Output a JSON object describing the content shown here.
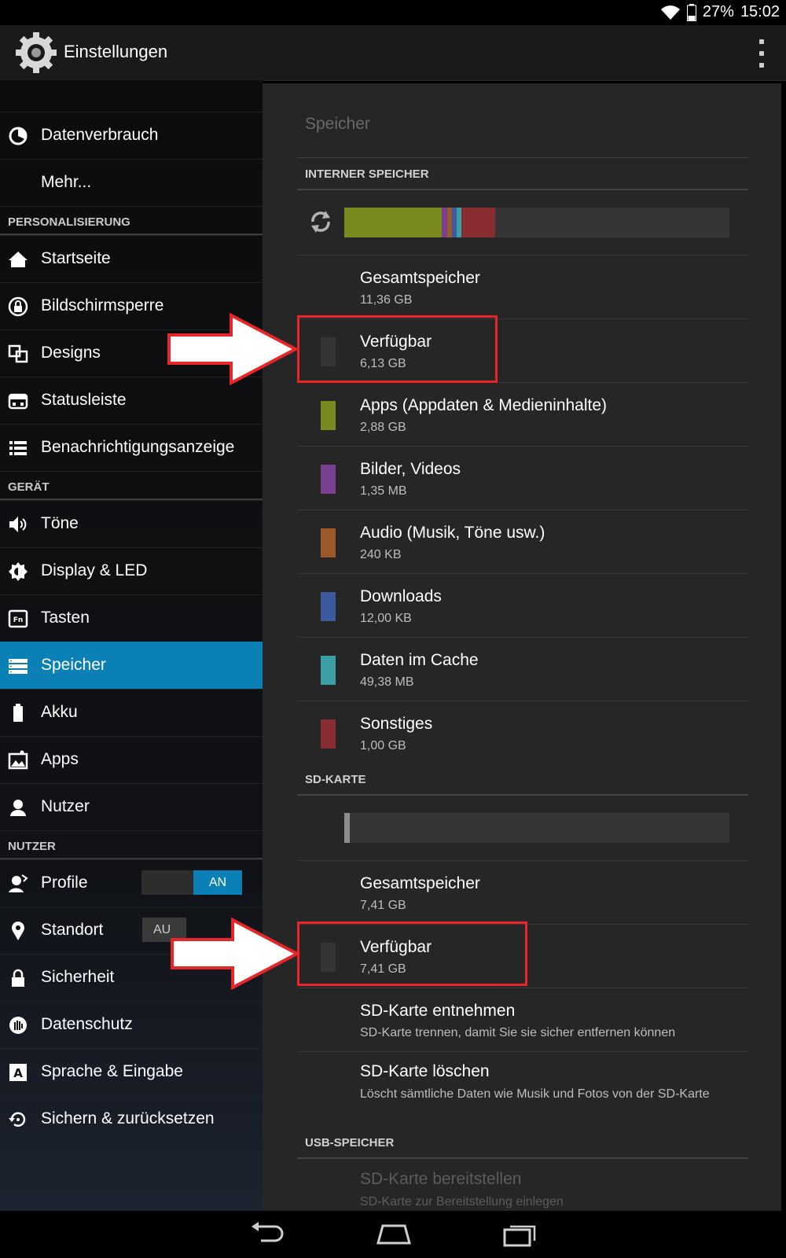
{
  "status": {
    "battery": "27%",
    "time": "15:02"
  },
  "app": {
    "title": "Einstellungen"
  },
  "sidebar": {
    "items_top": [
      {
        "label": "Datenverbrauch",
        "icon": "data-usage-icon"
      },
      {
        "label": "Mehr...",
        "icon": ""
      }
    ],
    "sections": [
      {
        "header": "PERSONALISIERUNG",
        "items": [
          {
            "label": "Startseite",
            "icon": "home-icon"
          },
          {
            "label": "Bildschirmsperre",
            "icon": "lock-screen-icon"
          },
          {
            "label": "Designs",
            "icon": "themes-icon"
          },
          {
            "label": "Statusleiste",
            "icon": "status-bar-icon"
          },
          {
            "label": "Benachrichtigungsanzeige",
            "icon": "notification-list-icon"
          }
        ]
      },
      {
        "header": "GERÄT",
        "items": [
          {
            "label": "Töne",
            "icon": "sound-icon"
          },
          {
            "label": "Display & LED",
            "icon": "display-brightness-icon"
          },
          {
            "label": "Tasten",
            "icon": "fn-key-icon"
          },
          {
            "label": "Speicher",
            "icon": "storage-icon",
            "active": true
          },
          {
            "label": "Akku",
            "icon": "battery-icon"
          },
          {
            "label": "Apps",
            "icon": "apps-icon"
          },
          {
            "label": "Nutzer",
            "icon": "user-icon"
          }
        ]
      },
      {
        "header": "NUTZER",
        "items": [
          {
            "label": "Profile",
            "icon": "profile-icon",
            "toggle": "AN"
          },
          {
            "label": "Standort",
            "icon": "location-pin-icon",
            "toggle": "AU"
          },
          {
            "label": "Sicherheit",
            "icon": "padlock-icon"
          },
          {
            "label": "Datenschutz",
            "icon": "privacy-hand-icon"
          },
          {
            "label": "Sprache & Eingabe",
            "icon": "language-icon"
          },
          {
            "label": "Sichern & zurücksetzen",
            "icon": "backup-restore-icon"
          }
        ]
      }
    ]
  },
  "content": {
    "breadcrumb": "Speicher",
    "internal": {
      "header": "INTERNER SPEICHER",
      "bar_segments": [
        {
          "fraction": 0.253,
          "color": "#7a8a1e"
        },
        {
          "fraction": 0.014,
          "color": "#7a3f8f"
        },
        {
          "fraction": 0.012,
          "color": "#9c5a2a"
        },
        {
          "fraction": 0.012,
          "color": "#3d5aa0"
        },
        {
          "fraction": 0.012,
          "color": "#3aa0a4"
        },
        {
          "fraction": 0.088,
          "color": "#8a2d32"
        }
      ],
      "items": [
        {
          "title": "Gesamtspeicher",
          "value": "11,36 GB",
          "color": ""
        },
        {
          "title": "Verfügbar",
          "value": "6,13 GB",
          "color": "#353535"
        },
        {
          "title": "Apps (Appdaten & Medieninhalte)",
          "value": "2,88 GB",
          "color": "#7a8a1e"
        },
        {
          "title": "Bilder, Videos",
          "value": "1,35 MB",
          "color": "#7a3f8f"
        },
        {
          "title": "Audio (Musik, Töne usw.)",
          "value": "240 KB",
          "color": "#9c5a2a"
        },
        {
          "title": "Downloads",
          "value": "12,00 KB",
          "color": "#3d5aa0"
        },
        {
          "title": "Daten im Cache",
          "value": "49,38 MB",
          "color": "#3aa0a4"
        },
        {
          "title": "Sonstiges",
          "value": "1,00 GB",
          "color": "#8a2d32"
        }
      ]
    },
    "sd": {
      "header": "SD-KARTE",
      "items": [
        {
          "title": "Gesamtspeicher",
          "value": "7,41 GB"
        },
        {
          "title": "Verfügbar",
          "value": "7,41 GB"
        },
        {
          "title": "SD-Karte entnehmen",
          "value": "SD-Karte trennen, damit Sie sie sicher entfernen können"
        },
        {
          "title": "SD-Karte löschen",
          "value": "Löscht sämtliche Daten wie Musik und Fotos von der SD-Karte"
        }
      ]
    },
    "usb": {
      "header": "USB-SPEICHER",
      "items": [
        {
          "title": "SD-Karte bereitstellen",
          "value": "SD-Karte zur Bereitstellung einlegen"
        }
      ]
    }
  },
  "colors": {
    "accent": "#0a80b6",
    "annotation": "#e8262a"
  }
}
